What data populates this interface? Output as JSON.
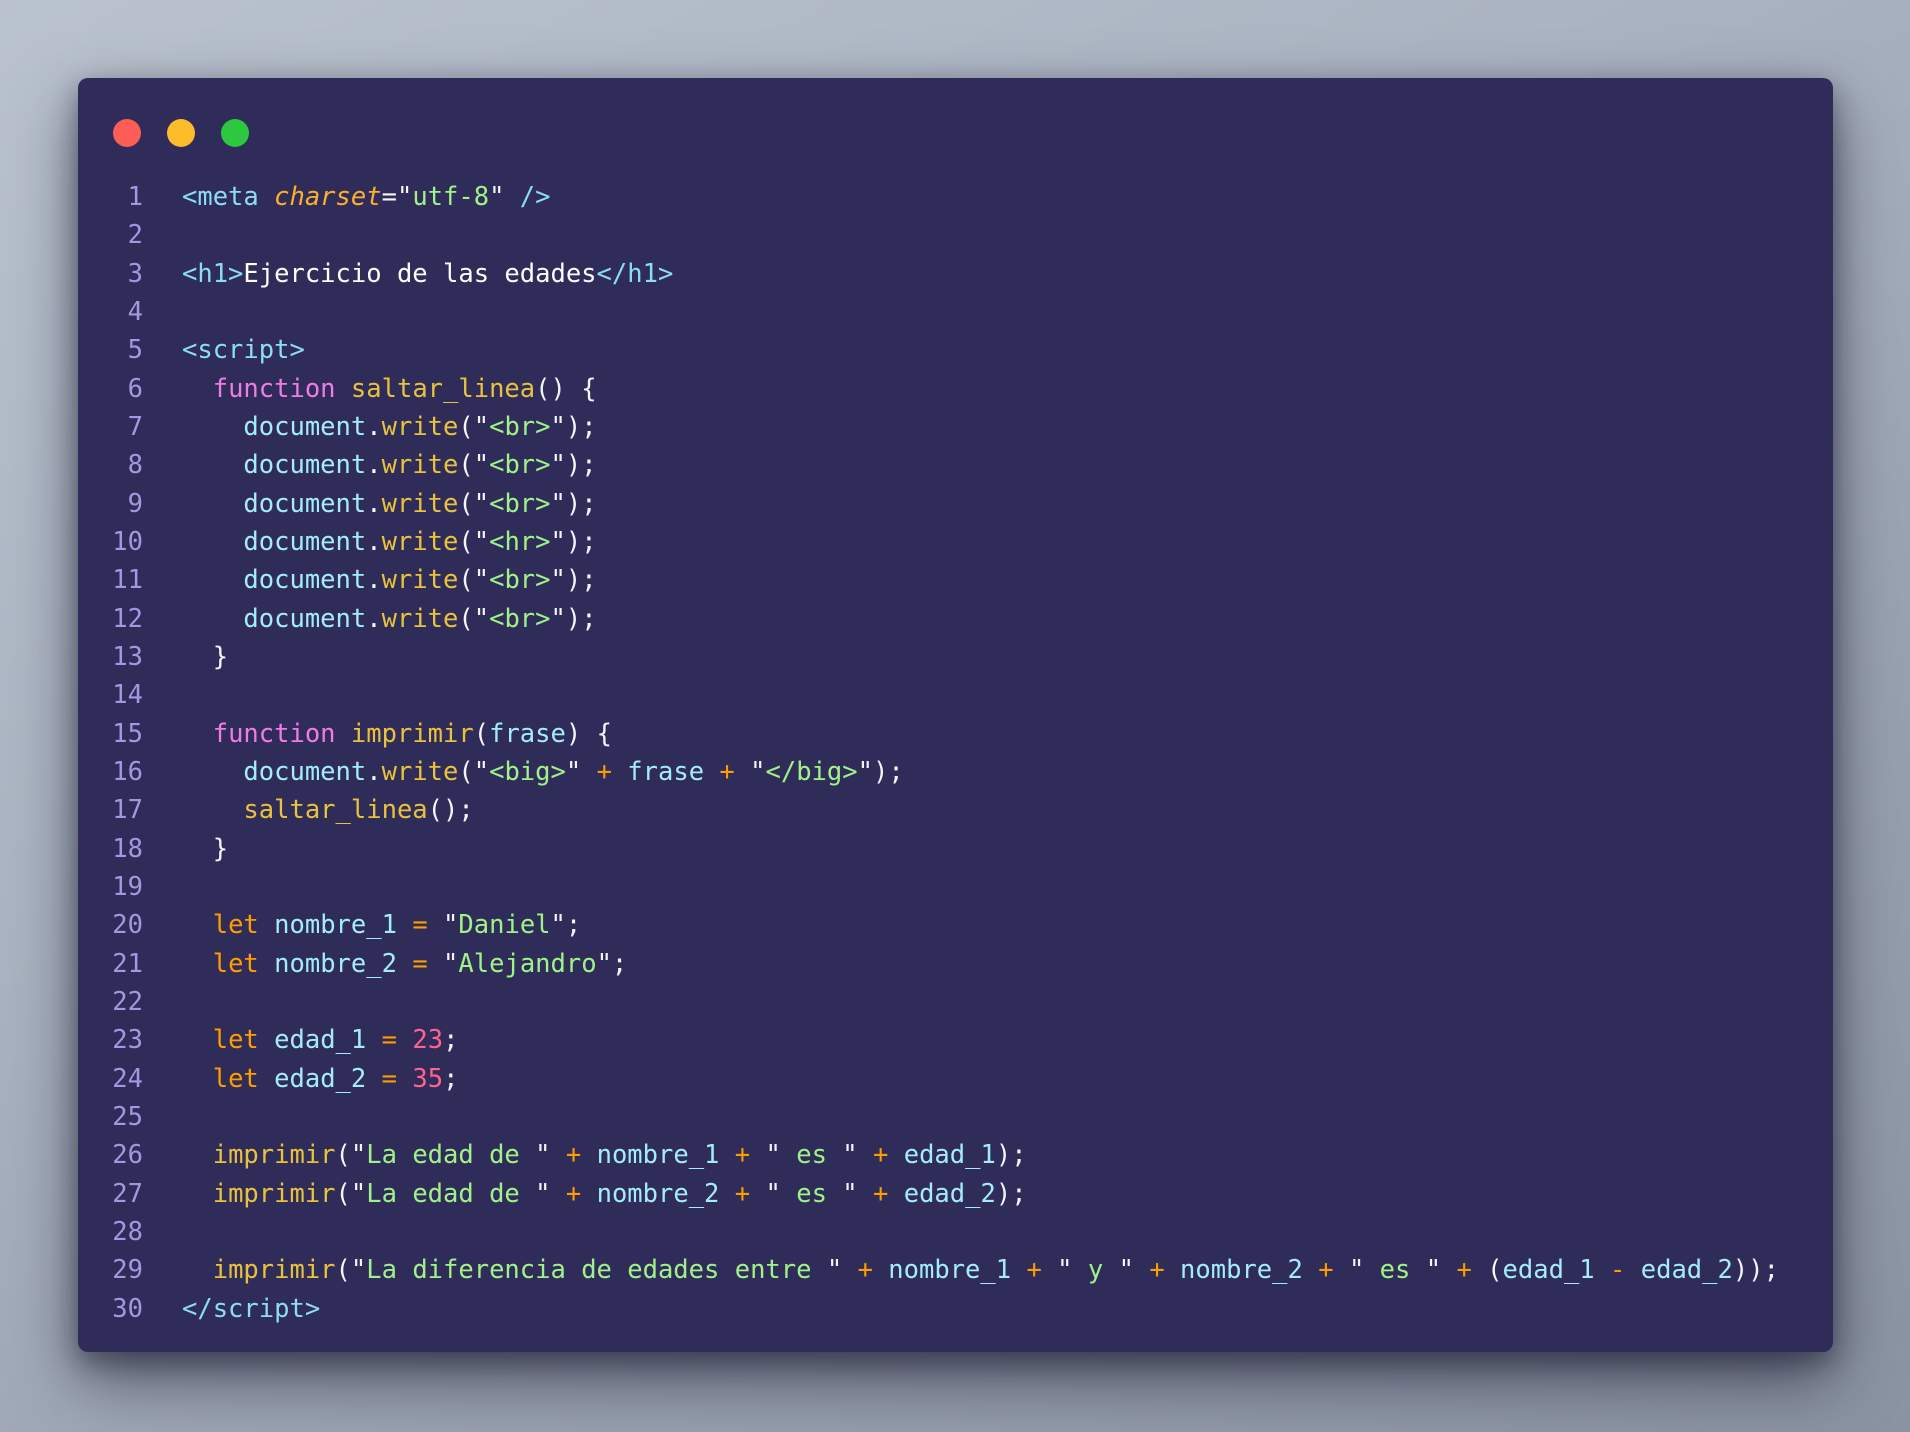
{
  "window": {
    "kind": "code-snippet-window",
    "background_color": "#2f2c5a",
    "traffic_lights": [
      {
        "name": "close",
        "color": "#ff5e57"
      },
      {
        "name": "minimize",
        "color": "#fdbc2c"
      },
      {
        "name": "zoom",
        "color": "#2bc840"
      }
    ]
  },
  "colors": {
    "page_background_top": "#b9c2ce",
    "page_background_bottom": "#8a93a2",
    "line_number": "#a199e0",
    "tag": "#8bdcf4",
    "attribute_italic": "#fcae2e",
    "identifier": "#a4ecf8",
    "function_name": "#e8c23c",
    "keyword_pink": "#ef7ce4",
    "keyword_operator_orange": "#ff9d00",
    "string": "#a0f288",
    "number": "#ff628c",
    "punctuation": "#f4f4fa"
  },
  "code": {
    "language": "html-javascript",
    "lines": [
      {
        "n": 1,
        "t": [
          [
            "tag",
            "<meta "
          ],
          [
            "attr",
            "charset"
          ],
          [
            "pun",
            "=\""
          ],
          [
            "str",
            "utf-8"
          ],
          [
            "pun",
            "\""
          ],
          [
            "tag",
            " />"
          ]
        ]
      },
      {
        "n": 2,
        "t": []
      },
      {
        "n": 3,
        "t": [
          [
            "tag",
            "<h1>"
          ],
          [
            "txt",
            "Ejercicio de las edades"
          ],
          [
            "tag",
            "</h1>"
          ]
        ]
      },
      {
        "n": 4,
        "t": []
      },
      {
        "n": 5,
        "t": [
          [
            "tag",
            "<script>"
          ]
        ]
      },
      {
        "n": 6,
        "t": [
          [
            "pun",
            "  "
          ],
          [
            "kw",
            "function"
          ],
          [
            "pun",
            " "
          ],
          [
            "fn",
            "saltar_linea"
          ],
          [
            "pun",
            "() {"
          ]
        ]
      },
      {
        "n": 7,
        "t": [
          [
            "pun",
            "    "
          ],
          [
            "ident",
            "document"
          ],
          [
            "pun",
            "."
          ],
          [
            "fn",
            "write"
          ],
          [
            "pun",
            "(\""
          ],
          [
            "str",
            "<br>"
          ],
          [
            "pun",
            "\");"
          ]
        ]
      },
      {
        "n": 8,
        "t": [
          [
            "pun",
            "    "
          ],
          [
            "ident",
            "document"
          ],
          [
            "pun",
            "."
          ],
          [
            "fn",
            "write"
          ],
          [
            "pun",
            "(\""
          ],
          [
            "str",
            "<br>"
          ],
          [
            "pun",
            "\");"
          ]
        ]
      },
      {
        "n": 9,
        "t": [
          [
            "pun",
            "    "
          ],
          [
            "ident",
            "document"
          ],
          [
            "pun",
            "."
          ],
          [
            "fn",
            "write"
          ],
          [
            "pun",
            "(\""
          ],
          [
            "str",
            "<br>"
          ],
          [
            "pun",
            "\");"
          ]
        ]
      },
      {
        "n": 10,
        "t": [
          [
            "pun",
            "    "
          ],
          [
            "ident",
            "document"
          ],
          [
            "pun",
            "."
          ],
          [
            "fn",
            "write"
          ],
          [
            "pun",
            "(\""
          ],
          [
            "str",
            "<hr>"
          ],
          [
            "pun",
            "\");"
          ]
        ]
      },
      {
        "n": 11,
        "t": [
          [
            "pun",
            "    "
          ],
          [
            "ident",
            "document"
          ],
          [
            "pun",
            "."
          ],
          [
            "fn",
            "write"
          ],
          [
            "pun",
            "(\""
          ],
          [
            "str",
            "<br>"
          ],
          [
            "pun",
            "\");"
          ]
        ]
      },
      {
        "n": 12,
        "t": [
          [
            "pun",
            "    "
          ],
          [
            "ident",
            "document"
          ],
          [
            "pun",
            "."
          ],
          [
            "fn",
            "write"
          ],
          [
            "pun",
            "(\""
          ],
          [
            "str",
            "<br>"
          ],
          [
            "pun",
            "\");"
          ]
        ]
      },
      {
        "n": 13,
        "t": [
          [
            "pun",
            "  }"
          ]
        ]
      },
      {
        "n": 14,
        "t": []
      },
      {
        "n": 15,
        "t": [
          [
            "pun",
            "  "
          ],
          [
            "kw",
            "function"
          ],
          [
            "pun",
            " "
          ],
          [
            "fn",
            "imprimir"
          ],
          [
            "pun",
            "("
          ],
          [
            "ident",
            "frase"
          ],
          [
            "pun",
            ") {"
          ]
        ]
      },
      {
        "n": 16,
        "t": [
          [
            "pun",
            "    "
          ],
          [
            "ident",
            "document"
          ],
          [
            "pun",
            "."
          ],
          [
            "fn",
            "write"
          ],
          [
            "pun",
            "(\""
          ],
          [
            "str",
            "<big>"
          ],
          [
            "pun",
            "\" "
          ],
          [
            "op",
            "+"
          ],
          [
            "pun",
            " "
          ],
          [
            "ident",
            "frase"
          ],
          [
            "pun",
            " "
          ],
          [
            "op",
            "+"
          ],
          [
            "pun",
            " \""
          ],
          [
            "str",
            "</big>"
          ],
          [
            "pun",
            "\");"
          ]
        ]
      },
      {
        "n": 17,
        "t": [
          [
            "pun",
            "    "
          ],
          [
            "fn",
            "saltar_linea"
          ],
          [
            "pun",
            "();"
          ]
        ]
      },
      {
        "n": 18,
        "t": [
          [
            "pun",
            "  }"
          ]
        ]
      },
      {
        "n": 19,
        "t": []
      },
      {
        "n": 20,
        "t": [
          [
            "pun",
            "  "
          ],
          [
            "op",
            "let"
          ],
          [
            "pun",
            " "
          ],
          [
            "ident",
            "nombre_1"
          ],
          [
            "pun",
            " "
          ],
          [
            "op",
            "="
          ],
          [
            "pun",
            " \""
          ],
          [
            "str",
            "Daniel"
          ],
          [
            "pun",
            "\";"
          ]
        ]
      },
      {
        "n": 21,
        "t": [
          [
            "pun",
            "  "
          ],
          [
            "op",
            "let"
          ],
          [
            "pun",
            " "
          ],
          [
            "ident",
            "nombre_2"
          ],
          [
            "pun",
            " "
          ],
          [
            "op",
            "="
          ],
          [
            "pun",
            " \""
          ],
          [
            "str",
            "Alejandro"
          ],
          [
            "pun",
            "\";"
          ]
        ]
      },
      {
        "n": 22,
        "t": []
      },
      {
        "n": 23,
        "t": [
          [
            "pun",
            "  "
          ],
          [
            "op",
            "let"
          ],
          [
            "pun",
            " "
          ],
          [
            "ident",
            "edad_1"
          ],
          [
            "pun",
            " "
          ],
          [
            "op",
            "="
          ],
          [
            "pun",
            " "
          ],
          [
            "num",
            "23"
          ],
          [
            "pun",
            ";"
          ]
        ]
      },
      {
        "n": 24,
        "t": [
          [
            "pun",
            "  "
          ],
          [
            "op",
            "let"
          ],
          [
            "pun",
            " "
          ],
          [
            "ident",
            "edad_2"
          ],
          [
            "pun",
            " "
          ],
          [
            "op",
            "="
          ],
          [
            "pun",
            " "
          ],
          [
            "num",
            "35"
          ],
          [
            "pun",
            ";"
          ]
        ]
      },
      {
        "n": 25,
        "t": []
      },
      {
        "n": 26,
        "t": [
          [
            "pun",
            "  "
          ],
          [
            "fn",
            "imprimir"
          ],
          [
            "pun",
            "(\""
          ],
          [
            "str",
            "La edad de "
          ],
          [
            "pun",
            "\" "
          ],
          [
            "op",
            "+"
          ],
          [
            "pun",
            " "
          ],
          [
            "ident",
            "nombre_1"
          ],
          [
            "pun",
            " "
          ],
          [
            "op",
            "+"
          ],
          [
            "pun",
            " \""
          ],
          [
            "str",
            " es "
          ],
          [
            "pun",
            "\" "
          ],
          [
            "op",
            "+"
          ],
          [
            "pun",
            " "
          ],
          [
            "ident",
            "edad_1"
          ],
          [
            "pun",
            ");"
          ]
        ]
      },
      {
        "n": 27,
        "t": [
          [
            "pun",
            "  "
          ],
          [
            "fn",
            "imprimir"
          ],
          [
            "pun",
            "(\""
          ],
          [
            "str",
            "La edad de "
          ],
          [
            "pun",
            "\" "
          ],
          [
            "op",
            "+"
          ],
          [
            "pun",
            " "
          ],
          [
            "ident",
            "nombre_2"
          ],
          [
            "pun",
            " "
          ],
          [
            "op",
            "+"
          ],
          [
            "pun",
            " \""
          ],
          [
            "str",
            " es "
          ],
          [
            "pun",
            "\" "
          ],
          [
            "op",
            "+"
          ],
          [
            "pun",
            " "
          ],
          [
            "ident",
            "edad_2"
          ],
          [
            "pun",
            ");"
          ]
        ]
      },
      {
        "n": 28,
        "t": []
      },
      {
        "n": 29,
        "t": [
          [
            "pun",
            "  "
          ],
          [
            "fn",
            "imprimir"
          ],
          [
            "pun",
            "(\""
          ],
          [
            "str",
            "La diferencia de edades entre "
          ],
          [
            "pun",
            "\" "
          ],
          [
            "op",
            "+"
          ],
          [
            "pun",
            " "
          ],
          [
            "ident",
            "nombre_1"
          ],
          [
            "pun",
            " "
          ],
          [
            "op",
            "+"
          ],
          [
            "pun",
            " \""
          ],
          [
            "str",
            " y "
          ],
          [
            "pun",
            "\" "
          ],
          [
            "op",
            "+"
          ],
          [
            "pun",
            " "
          ],
          [
            "ident",
            "nombre_2"
          ],
          [
            "pun",
            " "
          ],
          [
            "op",
            "+"
          ],
          [
            "pun",
            " \""
          ],
          [
            "str",
            " es "
          ],
          [
            "pun",
            "\" "
          ],
          [
            "op",
            "+"
          ],
          [
            "pun",
            " ("
          ],
          [
            "ident",
            "edad_1"
          ],
          [
            "pun",
            " "
          ],
          [
            "op",
            "-"
          ],
          [
            "pun",
            " "
          ],
          [
            "ident",
            "edad_2"
          ],
          [
            "pun",
            "));"
          ]
        ]
      },
      {
        "n": 30,
        "t": [
          [
            "tag",
            "</script>"
          ]
        ]
      }
    ]
  }
}
